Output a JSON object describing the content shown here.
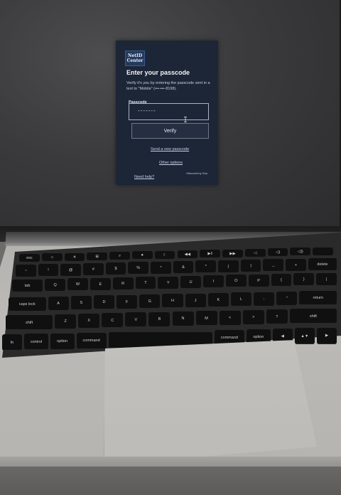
{
  "dialog": {
    "logo_line1": "NetID",
    "logo_line2": "Center",
    "title": "Enter your passcode",
    "description": "Verify it's you by entering the passcode sent in a text to \"Mobile\" (•••-•••-8198).",
    "passcode_label": "Passcode",
    "passcode_value": "-------",
    "verify_label": "Verify",
    "send_new_label": "Send a new passcode",
    "other_options_label": "Other options",
    "need_help_label": "Need help?",
    "secured_by": "•Secured by Duo"
  },
  "keyboard": {
    "rows": [
      [
        "esc",
        "☼",
        "☀",
        "⊞",
        "⌕",
        "⏺",
        "☾",
        "◀◀",
        "▶‖",
        "▶▶",
        "◁",
        "◁)",
        "◁))",
        ""
      ],
      [
        "~",
        "!",
        "@",
        "#",
        "$",
        "%",
        "^",
        "&",
        "*",
        "(",
        ")",
        "_",
        "+",
        "delete"
      ],
      [
        "tab",
        "Q",
        "W",
        "E",
        "R",
        "T",
        "Y",
        "U",
        "I",
        "O",
        "P",
        "{",
        "}",
        "|"
      ],
      [
        "caps lock",
        "A",
        "S",
        "D",
        "F",
        "G",
        "H",
        "J",
        "K",
        "L",
        ":",
        "\"",
        "return"
      ],
      [
        "shift",
        "Z",
        "X",
        "C",
        "V",
        "B",
        "N",
        "M",
        "<",
        ">",
        "?",
        "shift"
      ],
      [
        "fn",
        "control",
        "option",
        "command",
        "",
        "command",
        "option",
        "◀",
        "▲▼",
        "▶"
      ]
    ]
  },
  "colors": {
    "dialog_bg": "#1d2637",
    "screen_bg": "#3a3a3c",
    "key_bg": "#101011",
    "chassis": "#b6b4b0"
  }
}
